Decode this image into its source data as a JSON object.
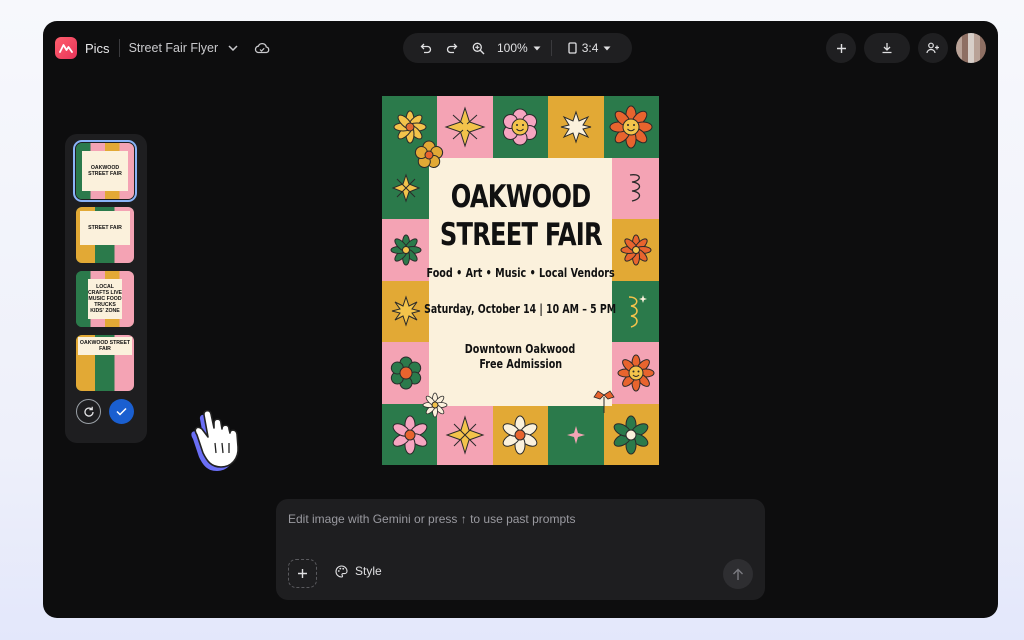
{
  "app": {
    "name": "Pics",
    "document_title": "Street Fair Flyer"
  },
  "toolbar": {
    "zoom": "100%",
    "aspect_ratio": "3:4"
  },
  "thumbnails": [
    {
      "label": "OAKWOOD STREET FAIR",
      "selected": true
    },
    {
      "label": "STREET FAIR",
      "selected": false
    },
    {
      "label": "LOCAL CRAFTS LIVE MUSIC FOOD TRUCKS KIDS' ZONE",
      "selected": false
    },
    {
      "label": "OAKWOOD STREET FAIR",
      "selected": false
    }
  ],
  "poster": {
    "title_line1": "OAKWOOD",
    "title_line2": "STREET FAIR",
    "subtitle": "Food • Art • Music • Local Vendors",
    "date": "Saturday, October 14 | 10 AM – 5 PM",
    "location_line1": "Downtown Oakwood",
    "location_line2": "Free Admission"
  },
  "prompt": {
    "placeholder": "Edit image with Gemini or press ↑ to use past prompts",
    "style_label": "Style"
  },
  "colors": {
    "green": "#2b7a4b",
    "pink": "#f4a3b4",
    "mustard": "#e2a935",
    "cream": "#fbf1dc",
    "accent_blue": "#1a5fd0"
  }
}
